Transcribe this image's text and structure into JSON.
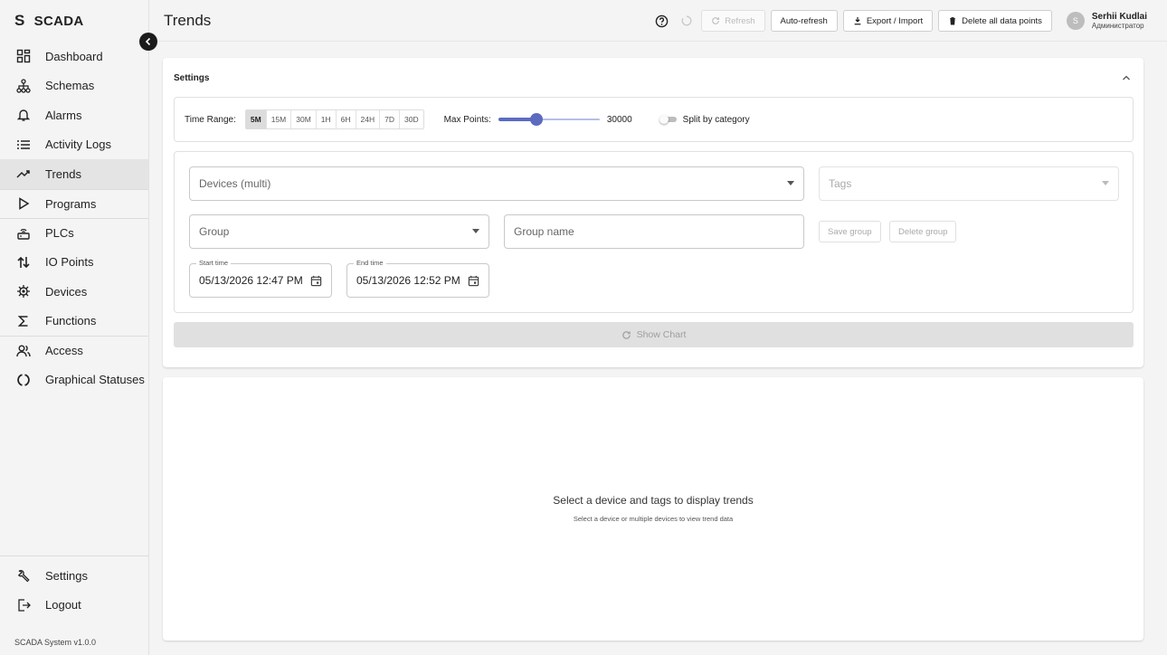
{
  "sidebar": {
    "brand_logo": "S",
    "brand_name": "SCADA",
    "items": [
      {
        "label": "Dashboard",
        "icon": "dashboard-icon"
      },
      {
        "label": "Schemas",
        "icon": "schema-icon"
      },
      {
        "label": "Alarms",
        "icon": "bell-icon"
      },
      {
        "label": "Activity Logs",
        "icon": "list-icon"
      },
      {
        "label": "Trends",
        "icon": "trend-icon",
        "active": true
      },
      {
        "label": "Programs",
        "icon": "play-icon"
      },
      {
        "label": "PLCs",
        "icon": "router-icon"
      },
      {
        "label": "IO Points",
        "icon": "io-icon"
      },
      {
        "label": "Devices",
        "icon": "chip-icon"
      },
      {
        "label": "Functions",
        "icon": "sigma-icon"
      },
      {
        "label": "Access",
        "icon": "people-icon"
      },
      {
        "label": "Graphical Statuses",
        "icon": "circle-icon"
      }
    ],
    "bottom_items": [
      {
        "label": "Settings",
        "icon": "wrench-icon"
      },
      {
        "label": "Logout",
        "icon": "logout-icon"
      }
    ],
    "version": "SCADA System v1.0.0"
  },
  "header": {
    "title": "Trends",
    "refresh_label": "Refresh",
    "auto_refresh_label": "Auto-refresh",
    "export_label": "Export / Import",
    "delete_label": "Delete all data points",
    "user_initial": "S",
    "user_name": "Serhii Kudlai",
    "user_role": "Администратор"
  },
  "settings": {
    "title": "Settings",
    "time_range_label": "Time Range:",
    "ranges": [
      "5M",
      "15M",
      "30M",
      "1H",
      "6H",
      "24H",
      "7D",
      "30D"
    ],
    "active_range": "5M",
    "max_points_label": "Max Points:",
    "max_points_value": "30000",
    "max_points_fraction": 0.38,
    "split_label": "Split by category",
    "split_enabled": false,
    "devices_placeholder": "Devices (multi)",
    "tags_placeholder": "Tags",
    "group_placeholder": "Group",
    "group_name_placeholder": "Group name",
    "save_group_label": "Save group",
    "delete_group_label": "Delete group",
    "start_time_label": "Start time",
    "start_time_value": "05/13/2026 12:47 PM",
    "end_time_label": "End time",
    "end_time_value": "05/13/2026 12:52 PM",
    "show_chart_label": "Show Chart"
  },
  "chart_area": {
    "empty_title": "Select a device and tags to display trends",
    "empty_subtitle": "Select a device or multiple devices to view trend data"
  }
}
